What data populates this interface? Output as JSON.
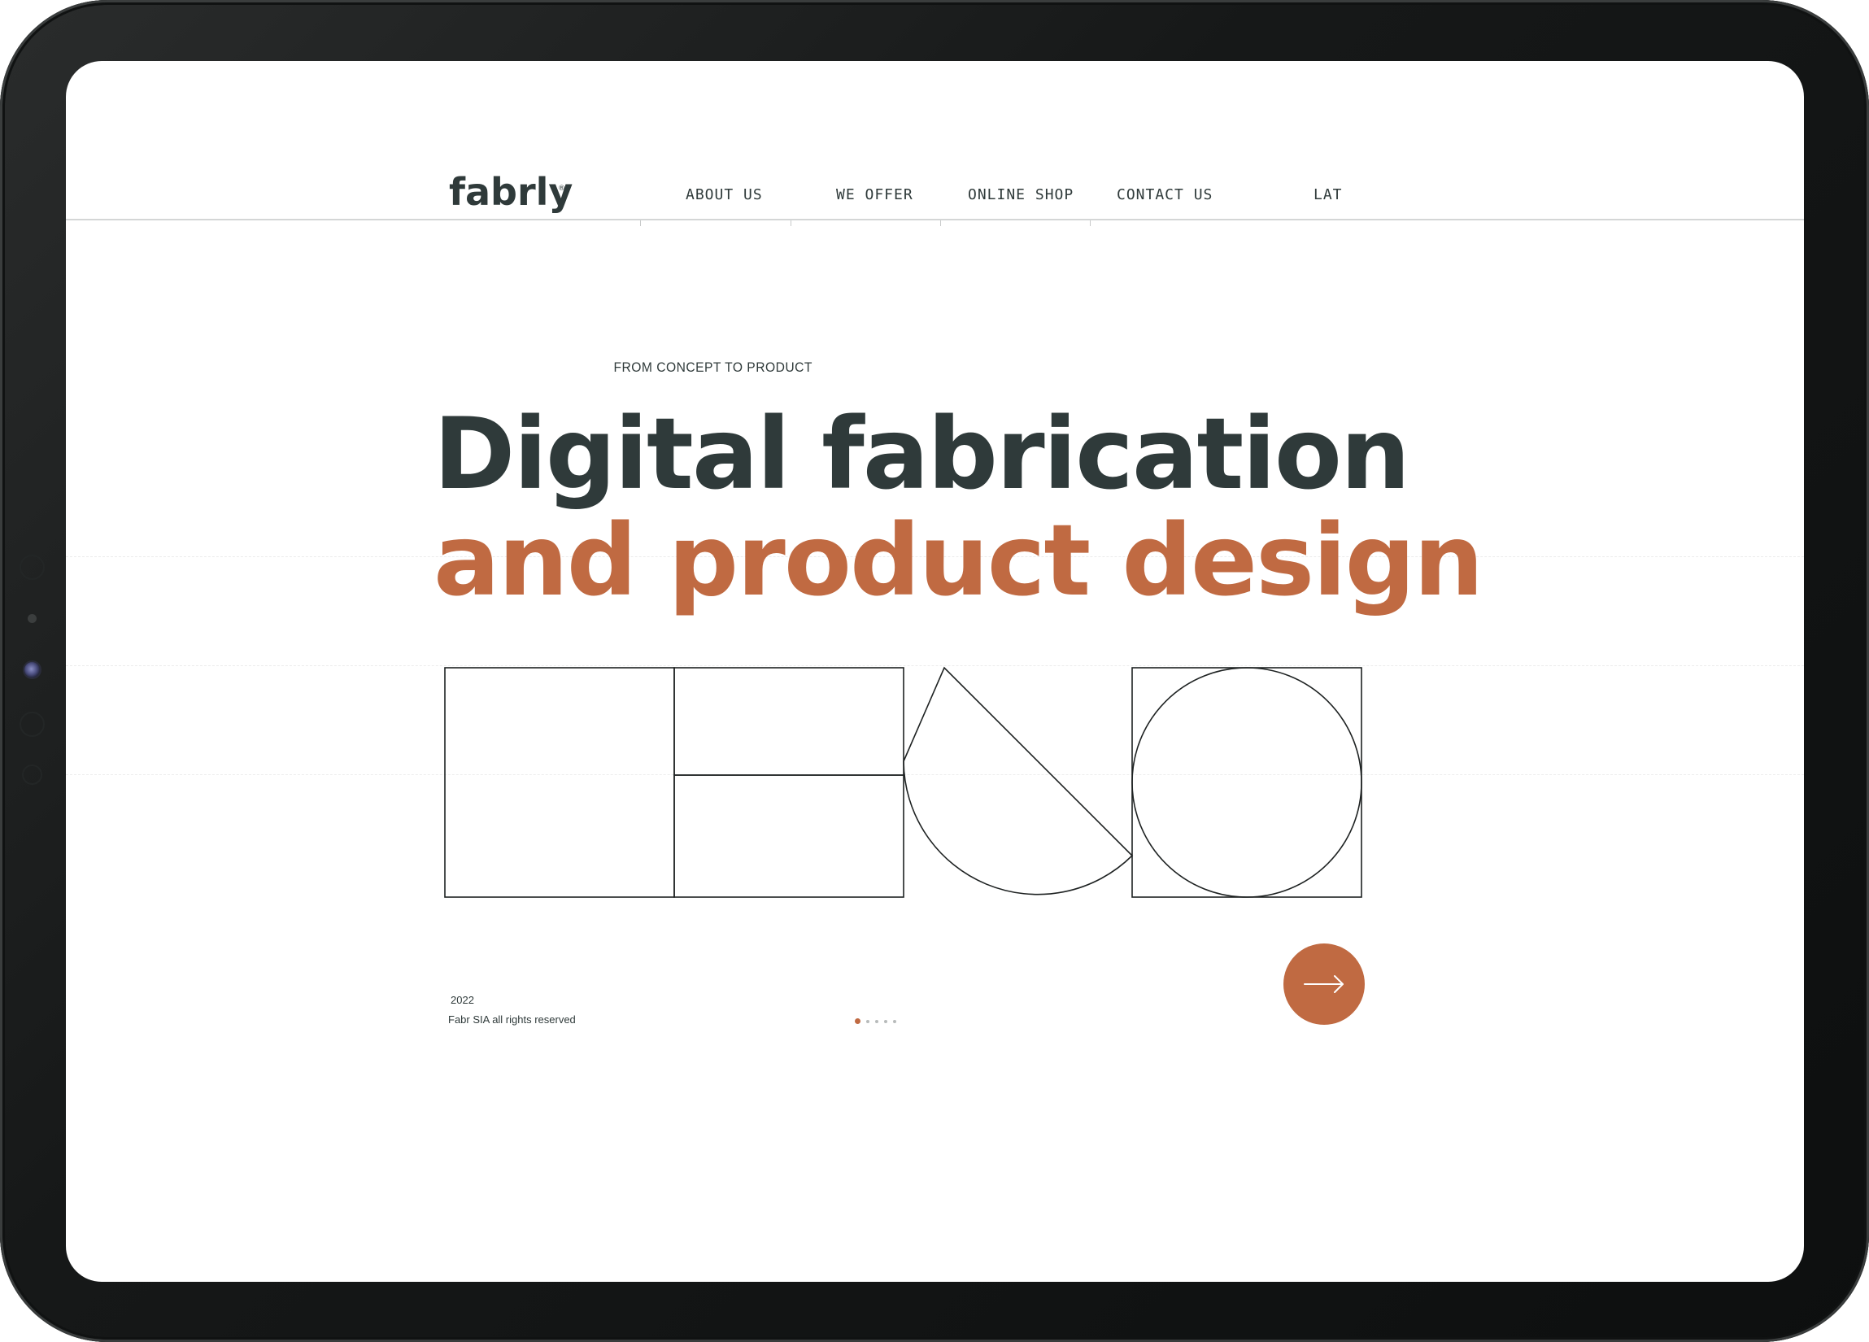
{
  "brand": {
    "logo_text": "fabrly",
    "registered_mark": "®",
    "accent_color": "#c06a42",
    "text_color": "#2f3a3a"
  },
  "nav": {
    "items": [
      {
        "label": "ABOUT US"
      },
      {
        "label": "WE OFFER"
      },
      {
        "label": "ONLINE SHOP"
      },
      {
        "label": "CONTACT US"
      }
    ],
    "language": "LAT"
  },
  "hero": {
    "eyebrow": "FROM CONCEPT TO PRODUCT",
    "headline_line1": "Digital fabrication",
    "headline_line2": "and product design"
  },
  "footer": {
    "year": "2022",
    "rights": "Fabr SIA all rights reserved"
  },
  "slider": {
    "total_slides": 5,
    "active_slide": 1,
    "next_icon": "arrow-right-icon"
  }
}
